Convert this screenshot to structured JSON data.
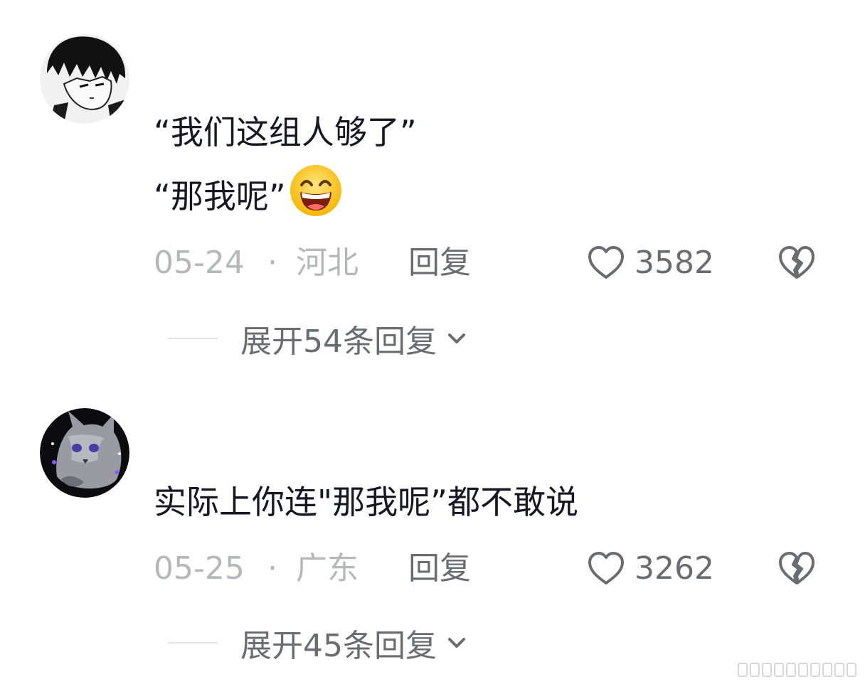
{
  "comments": [
    {
      "avatar": "anime-boy-avatar",
      "text_lines": [
        "“我们这组人够了”",
        "“那我呢”"
      ],
      "emoji": "grinning-face-emoji",
      "date": "05-24",
      "separator": "·",
      "region": "河北",
      "reply_label": "回复",
      "likes": "3582",
      "expand_label": "展开54条回复"
    },
    {
      "avatar": "cat-avatar",
      "text_lines": [
        "实际上你连\"那我呢”都不敢说"
      ],
      "date": "05-25",
      "separator": "·",
      "region": "广东",
      "reply_label": "回复",
      "likes": "3262",
      "expand_label": "展开45条回复"
    }
  ],
  "colors": {
    "text_primary": "#161823",
    "text_meta": "#b6b7bb",
    "text_action": "#6b6c72",
    "divider": "#e2e2e4"
  },
  "icons": [
    "heart-icon",
    "broken-heart-icon",
    "chevron-down-icon"
  ]
}
